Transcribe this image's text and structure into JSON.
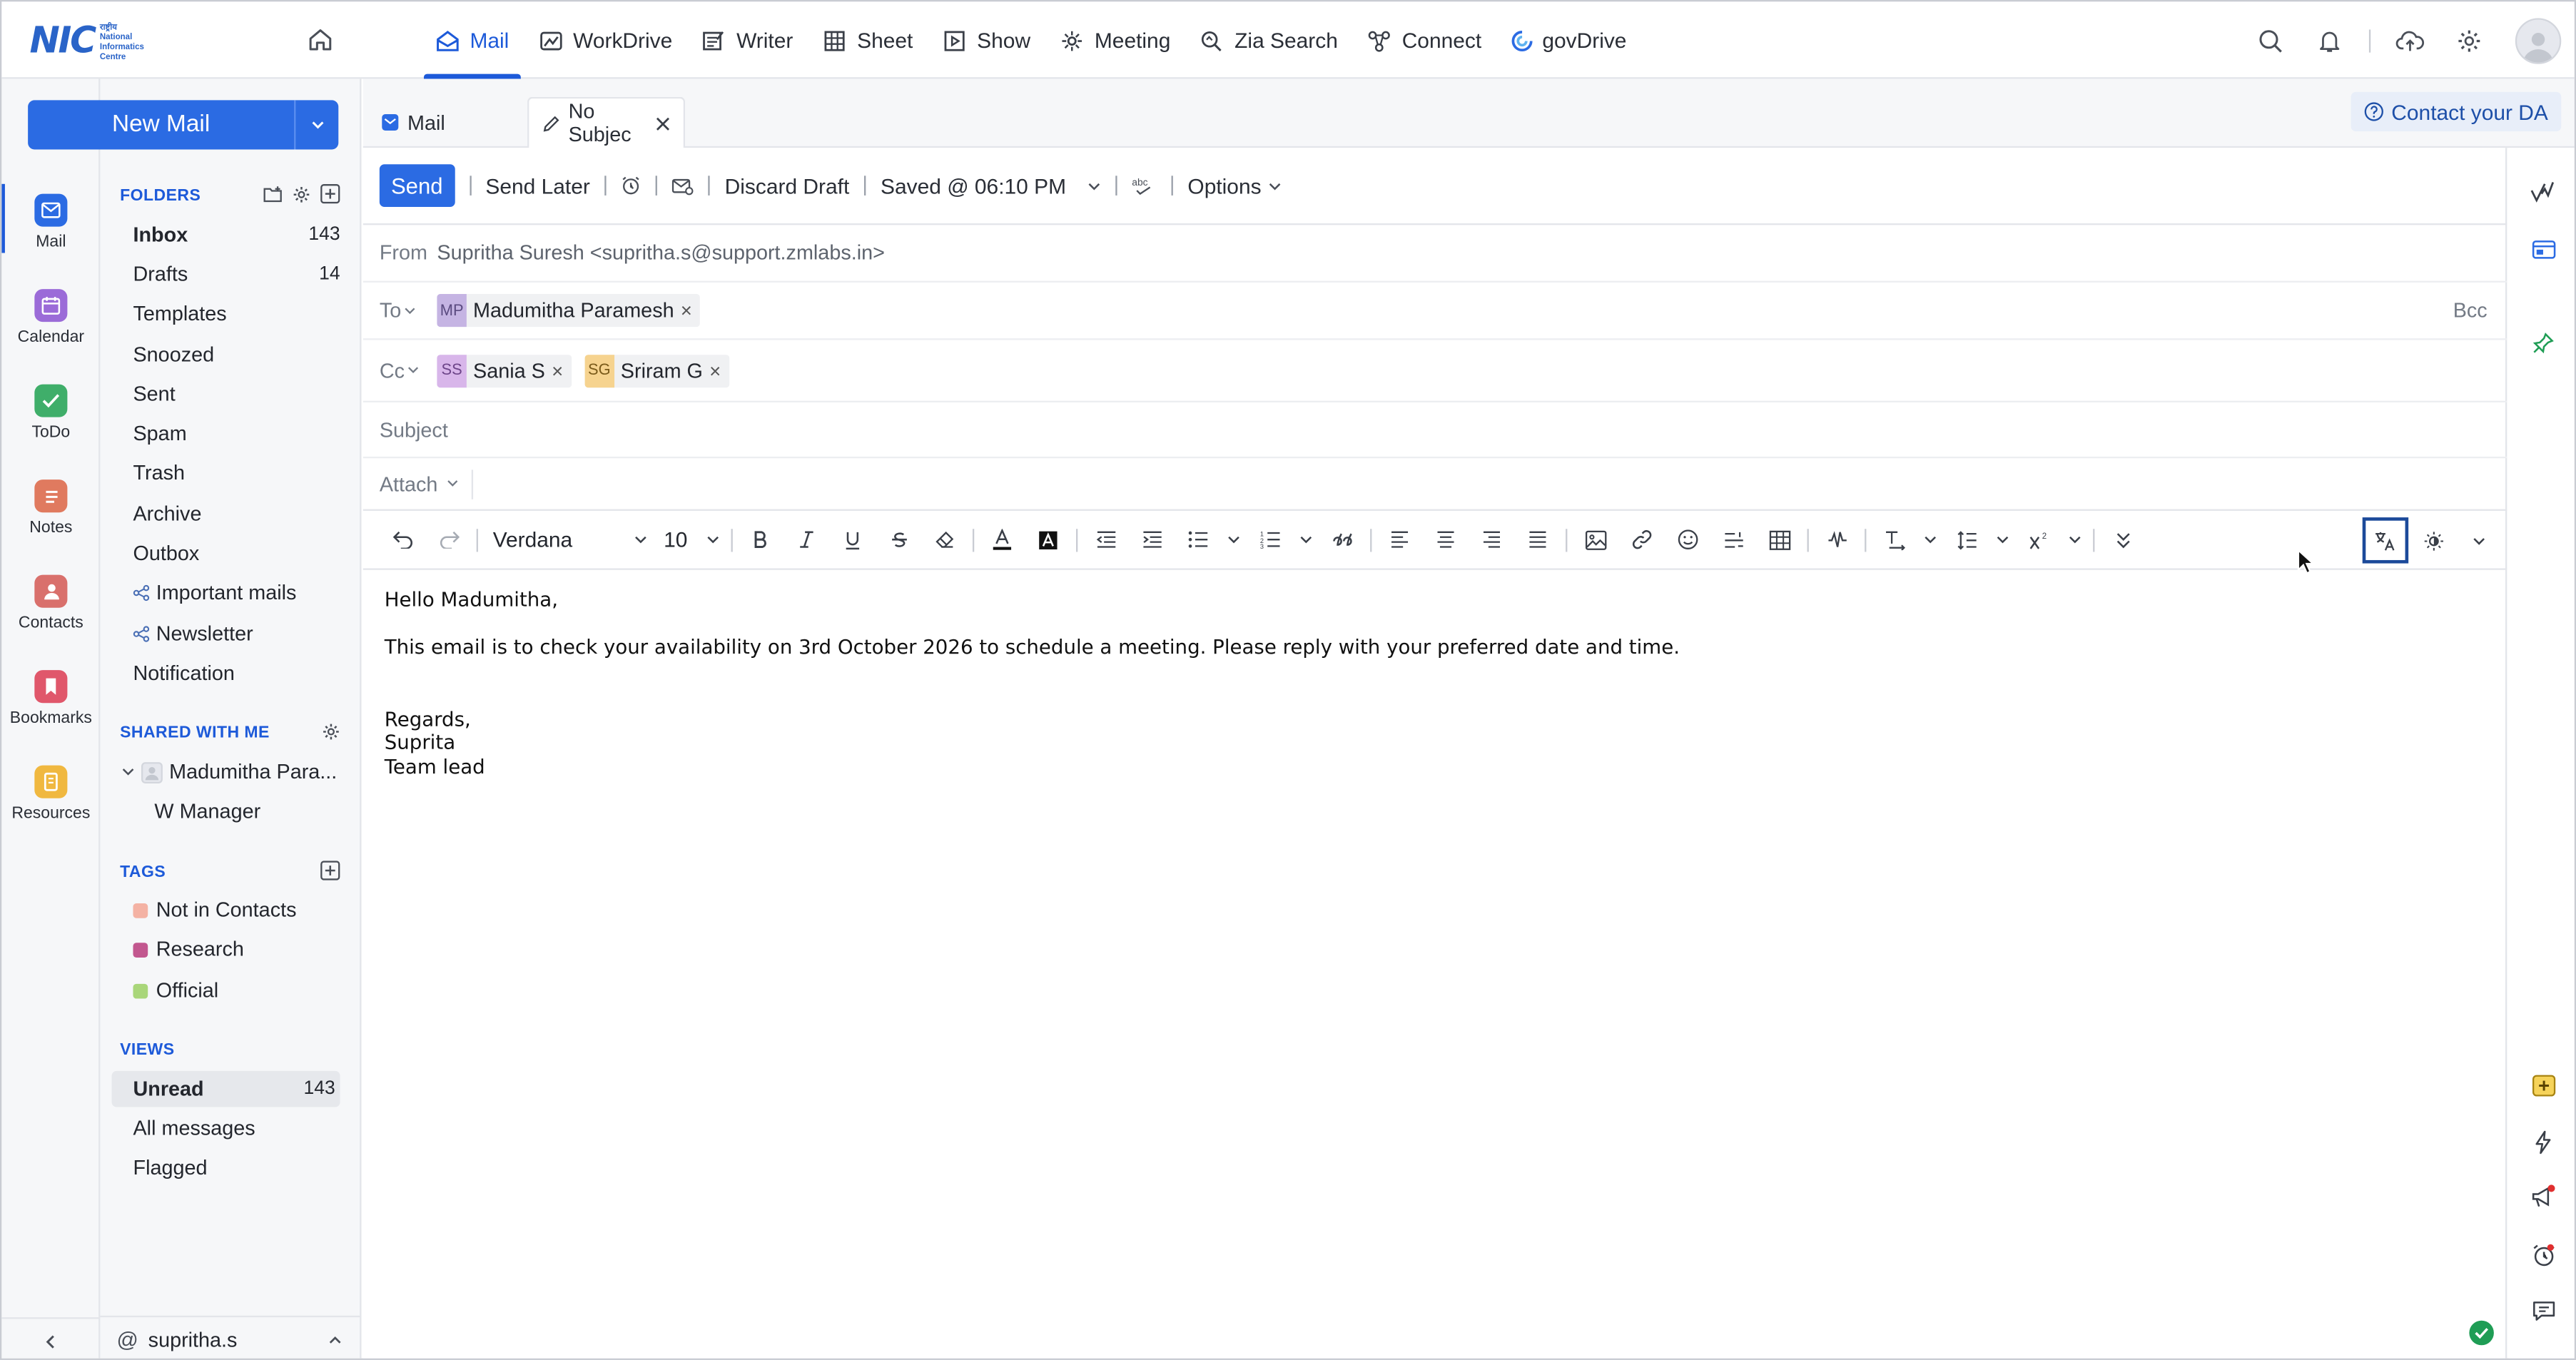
{
  "brand": {
    "logo_mark": "NIC",
    "logo_lines": [
      "राष्ट्रीय",
      "National",
      "Informatics",
      "Centre"
    ]
  },
  "topnav": {
    "apps": [
      {
        "label": "Mail",
        "icon": "mail-icon",
        "active": true
      },
      {
        "label": "WorkDrive",
        "icon": "workdrive-icon"
      },
      {
        "label": "Writer",
        "icon": "writer-icon"
      },
      {
        "label": "Sheet",
        "icon": "sheet-icon"
      },
      {
        "label": "Show",
        "icon": "show-icon"
      },
      {
        "label": "Meeting",
        "icon": "meeting-icon"
      },
      {
        "label": "Zia Search",
        "icon": "zia-search-icon"
      },
      {
        "label": "Connect",
        "icon": "connect-icon"
      },
      {
        "label": "govDrive",
        "icon": "govdrive-icon"
      }
    ]
  },
  "rail": {
    "items": [
      {
        "label": "Mail",
        "color": "#2b6be3"
      },
      {
        "label": "Calendar",
        "color": "#9b6bd8"
      },
      {
        "label": "ToDo",
        "color": "#3fae6a"
      },
      {
        "label": "Notes",
        "color": "#e07a5f"
      },
      {
        "label": "Contacts",
        "color": "#d9706c"
      },
      {
        "label": "Bookmarks",
        "color": "#e0576b"
      },
      {
        "label": "Resources",
        "color": "#f0b840"
      }
    ]
  },
  "compose": {
    "new_mail_label": "New Mail"
  },
  "folders": {
    "title": "FOLDERS",
    "items": [
      {
        "name": "Inbox",
        "count": "143",
        "bold": true
      },
      {
        "name": "Drafts",
        "count": "14"
      },
      {
        "name": "Templates",
        "count": ""
      },
      {
        "name": "Snoozed",
        "count": ""
      },
      {
        "name": "Sent",
        "count": ""
      },
      {
        "name": "Spam",
        "count": ""
      },
      {
        "name": "Trash",
        "count": ""
      },
      {
        "name": "Archive",
        "count": ""
      },
      {
        "name": "Outbox",
        "count": ""
      },
      {
        "name": "Important mails",
        "count": "",
        "shared": true
      },
      {
        "name": "Newsletter",
        "count": "",
        "shared": true
      },
      {
        "name": "Notification",
        "count": ""
      }
    ]
  },
  "shared": {
    "title": "SHARED WITH ME",
    "owner": "Madumitha Para...",
    "folder": "W Manager"
  },
  "tags": {
    "title": "TAGS",
    "items": [
      {
        "name": "Not in Contacts",
        "color": "#f4b2a4"
      },
      {
        "name": "Research",
        "color": "#c2578f"
      },
      {
        "name": "Official",
        "color": "#a9d67a"
      }
    ]
  },
  "views": {
    "title": "VIEWS",
    "items": [
      {
        "name": "Unread",
        "count": "143",
        "selected": true
      },
      {
        "name": "All messages",
        "count": ""
      },
      {
        "name": "Flagged",
        "count": ""
      }
    ]
  },
  "user": {
    "handle": "supritha.s"
  },
  "tabs": [
    {
      "label": "Mail"
    },
    {
      "label": "No Subjec"
    }
  ],
  "contact_da": "Contact your DA",
  "toolbar": {
    "send": "Send",
    "send_later": "Send Later",
    "discard": "Discard Draft",
    "saved": "Saved @ 06:10 PM",
    "options": "Options"
  },
  "fields": {
    "from_label": "From",
    "from_value": "Supritha Suresh <supritha.s@support.zmlabs.in>",
    "to_label": "To",
    "to": [
      {
        "initials": "MP",
        "name": "Madumitha Paramesh",
        "color": "#c5b4e3"
      }
    ],
    "bcc": "Bcc",
    "cc_label": "Cc",
    "cc": [
      {
        "initials": "SS",
        "name": "Sania S",
        "color": "#d8b6ea"
      },
      {
        "initials": "SG",
        "name": "Sriram G",
        "color": "#f6d38f"
      }
    ],
    "subject_placeholder": "Subject",
    "attach_label": "Attach"
  },
  "format": {
    "font": "Verdana",
    "size": "10"
  },
  "body": {
    "greeting": "Hello Madumitha,",
    "line1": "This email is to check your availability on 3rd October 2026 to schedule a meeting. Please reply with your preferred date and time.",
    "closing": "Regards,",
    "sig_name": "Suprita",
    "sig_title": "Team lead"
  }
}
